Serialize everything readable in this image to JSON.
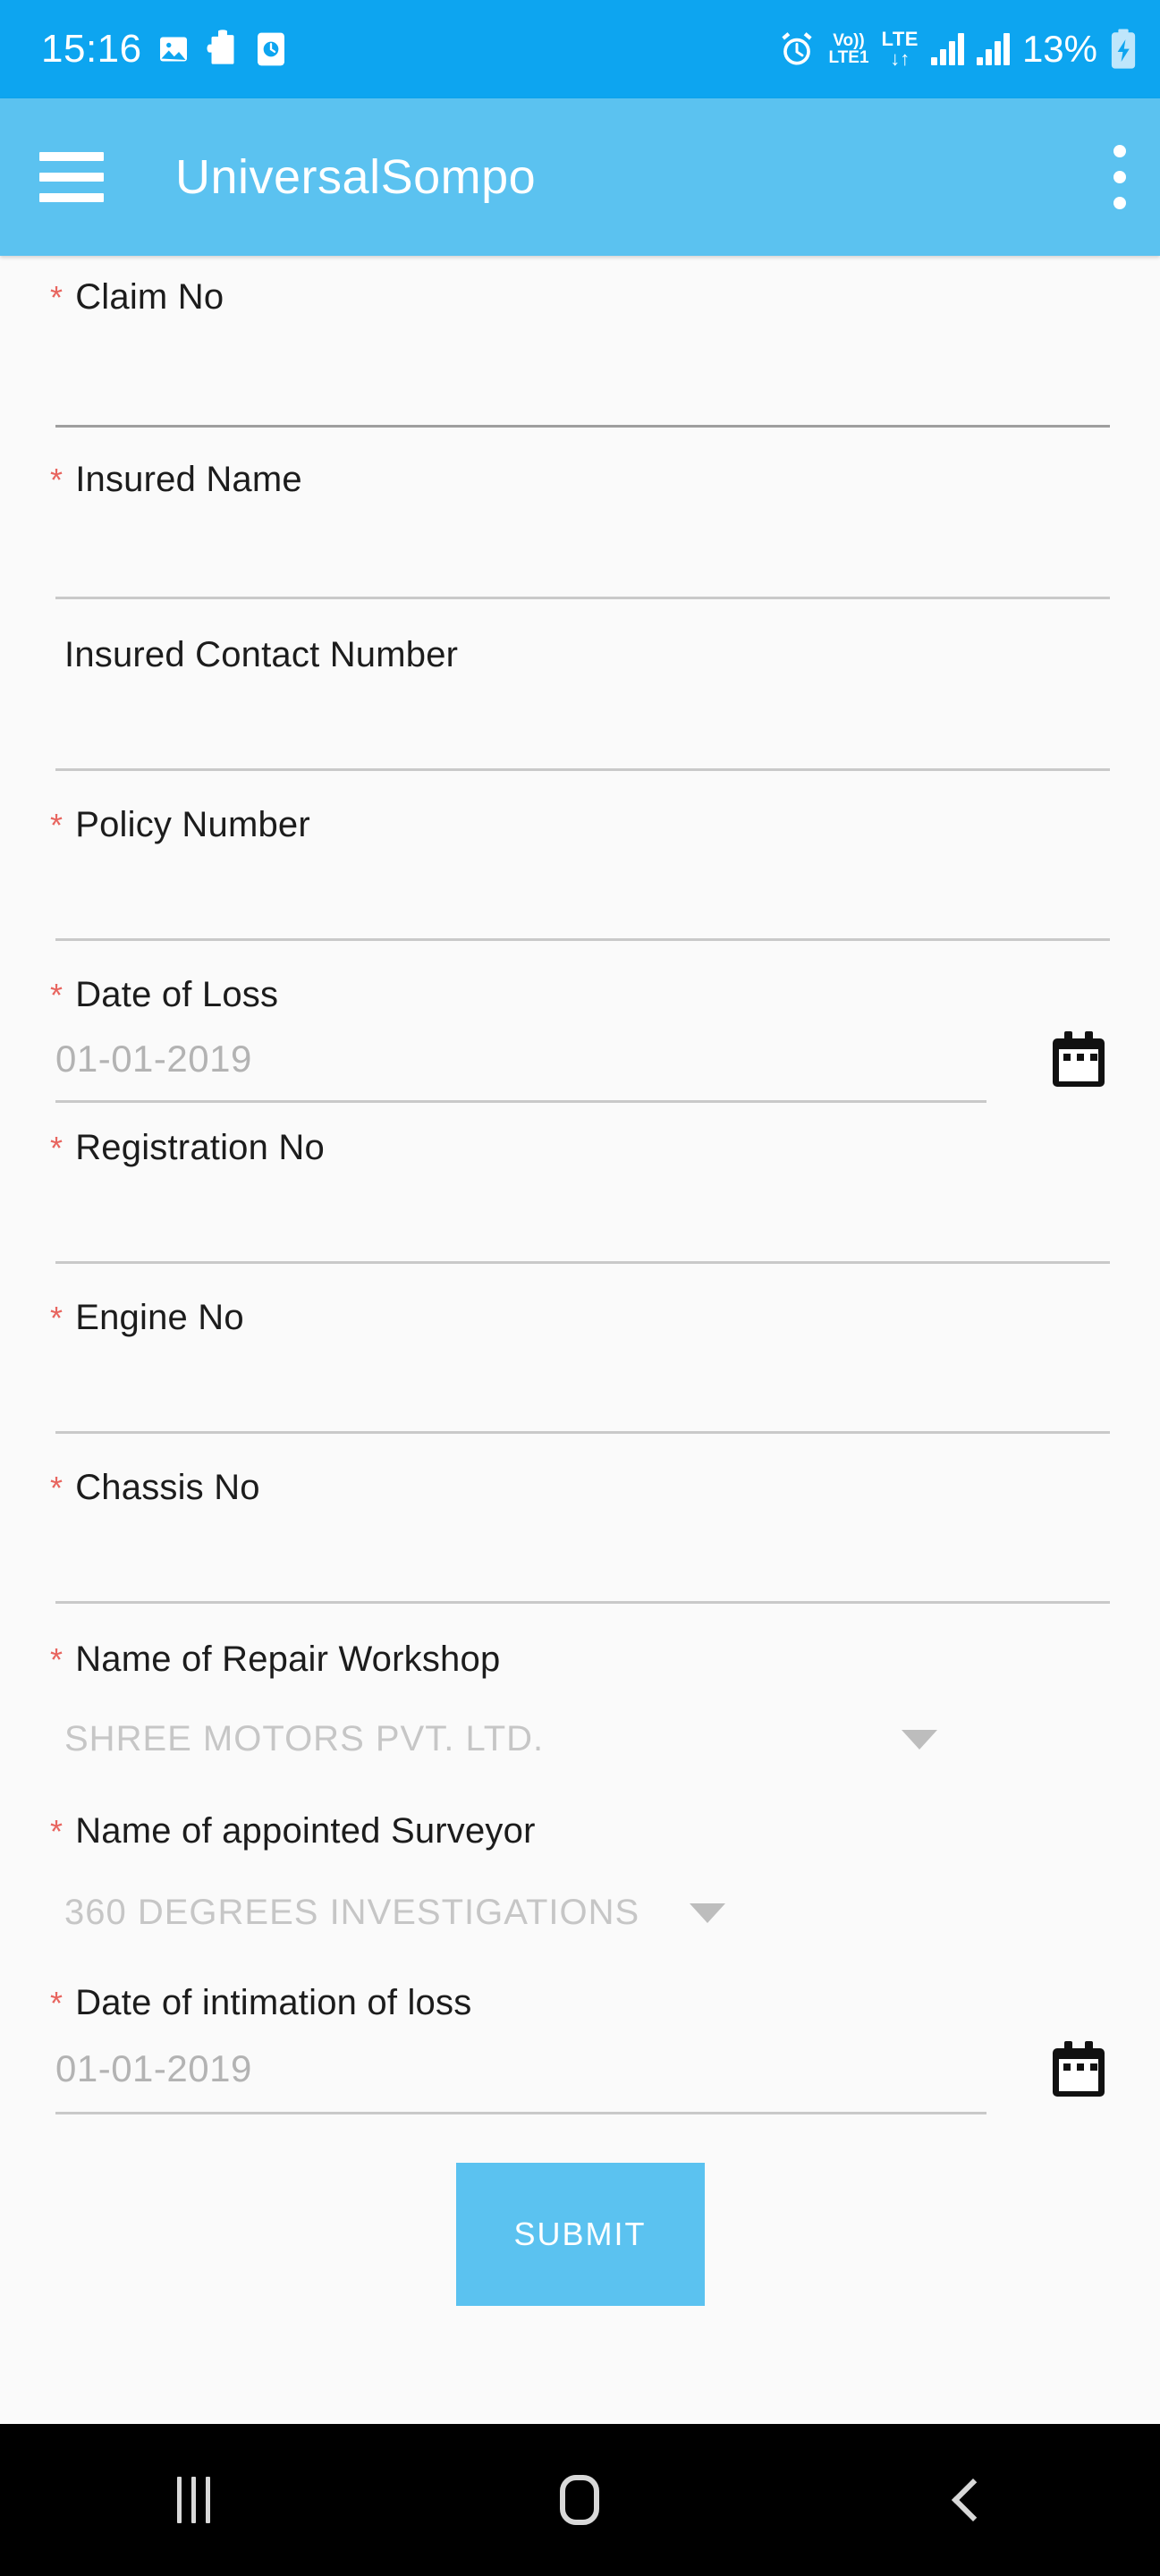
{
  "status_bar": {
    "time": "15:16",
    "battery": "13%",
    "icons_left": [
      "image-icon",
      "puzzle-icon",
      "clock-card-icon"
    ],
    "icons_right": [
      "alarm-icon",
      "volte-icon",
      "lte-data-icon",
      "signal-icon-sim1",
      "signal-icon-sim2",
      "battery-charging-icon"
    ],
    "volte_top": "Vo))",
    "volte_bottom": "LTE1",
    "lte_top": "LTE",
    "lte_bottom": "↓↑",
    "background_color": "#0da5f0"
  },
  "app_bar": {
    "title": "UniversalSompo",
    "menu_icon": "hamburger-icon",
    "overflow_icon": "overflow-menu-icon",
    "background_color": "#5bc2f0"
  },
  "form": {
    "required_marker": "*",
    "fields": [
      {
        "label": "Claim No",
        "required": true,
        "type": "text",
        "value": "",
        "underline": "dark"
      },
      {
        "label": "Insured Name",
        "required": true,
        "type": "text",
        "value": "",
        "underline": "light"
      },
      {
        "label": "Insured Contact Number",
        "required": false,
        "type": "text",
        "value": "",
        "underline": "light"
      },
      {
        "label": "Policy Number",
        "required": true,
        "type": "text",
        "value": "",
        "underline": "light"
      },
      {
        "label": "Date of Loss",
        "required": true,
        "type": "date",
        "value": "01-01-2019",
        "underline": "light",
        "icon": "calendar-icon"
      },
      {
        "label": "Registration No",
        "required": true,
        "type": "text",
        "value": "",
        "underline": "light"
      },
      {
        "label": "Engine No",
        "required": true,
        "type": "text",
        "value": "",
        "underline": "light"
      },
      {
        "label": "Chassis No",
        "required": true,
        "type": "text",
        "value": "",
        "underline": "light"
      },
      {
        "label": "Name of Repair Workshop",
        "required": true,
        "type": "dropdown",
        "value": "SHREE MOTORS PVT. LTD.",
        "icon": "chevron-down-icon"
      },
      {
        "label": "Name of appointed Surveyor",
        "required": true,
        "type": "dropdown",
        "value": "360 DEGREES INVESTIGATIONS",
        "icon": "chevron-down-icon"
      },
      {
        "label": "Date of intimation of loss",
        "required": true,
        "type": "date",
        "value": "01-01-2019",
        "underline": "light",
        "icon": "calendar-icon"
      }
    ],
    "submit_label": "SUBMIT",
    "submit_color": "#5bc2f0",
    "required_color": "#e8655f"
  },
  "nav_bar": {
    "recents_icon": "recents-icon",
    "home_icon": "home-icon",
    "back_icon": "back-icon",
    "background_color": "#000000"
  }
}
